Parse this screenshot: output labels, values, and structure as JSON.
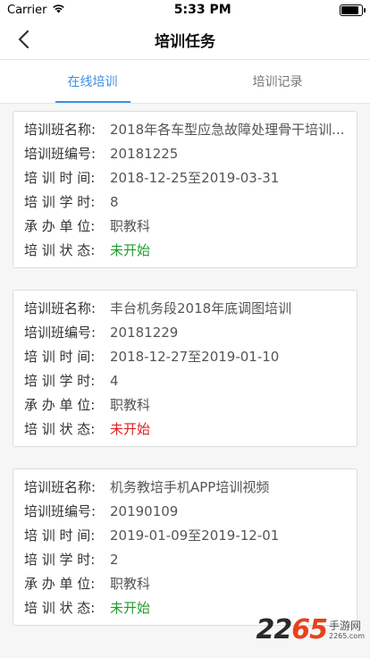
{
  "status": {
    "carrier": "Carrier",
    "time": "5:33 PM"
  },
  "nav": {
    "title": "培训任务"
  },
  "tabs": [
    {
      "label": "在线培训",
      "active": true
    },
    {
      "label": "培训记录",
      "active": false
    }
  ],
  "labels": {
    "name": "培训班名称:",
    "code": "培训班编号:",
    "time": "培 训 时 间:",
    "hours": "培 训 学 时:",
    "unit": "承 办 单 位:",
    "state": "培 训 状 态:"
  },
  "cards": [
    {
      "name": "2018年各车型应急故障处理骨干培训...",
      "code": "20181225",
      "time": "2018-12-25至2019-03-31",
      "hours": "8",
      "unit": "职教科",
      "state": "未开始",
      "state_color": "#1e9e2c"
    },
    {
      "name": "丰台机务段2018年底调图培训",
      "code": "20181229",
      "time": "2018-12-27至2019-01-10",
      "hours": "4",
      "unit": "职教科",
      "state": "未开始",
      "state_color": "#e02020"
    },
    {
      "name": "机务教培手机APP培训视频",
      "code": "20190109",
      "time": "2019-01-09至2019-12-01",
      "hours": "2",
      "unit": "职教科",
      "state": "未开始",
      "state_color": "#1e9e2c"
    }
  ],
  "watermark": {
    "number_a": "22",
    "number_b": "65",
    "line1": "手游网",
    "line2": "2265.com"
  },
  "colors": {
    "accent": "#3c8fe6",
    "green": "#1e9e2c",
    "red": "#e02020"
  }
}
